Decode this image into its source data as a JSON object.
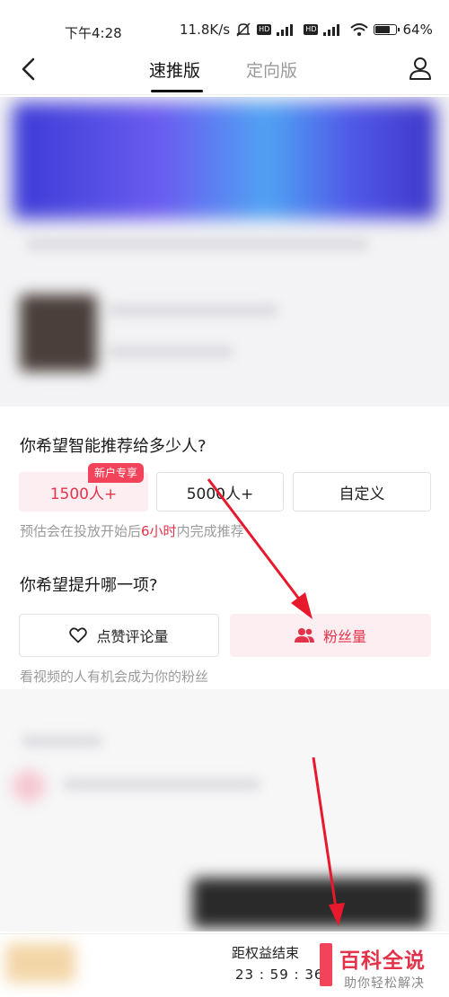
{
  "status_bar": {
    "time": "下午4:28",
    "net_speed": "11.8K/s",
    "hd1": "HD",
    "hd2": "HD",
    "battery": "64%",
    "battery_level": 0.64
  },
  "nav": {
    "tabs": [
      "速推版",
      "定向版"
    ],
    "active_tab": 0
  },
  "audience": {
    "title": "你希望智能推荐给多少人?",
    "options": [
      "1500人+",
      "5000人+",
      "自定义"
    ],
    "selected": 0,
    "new_badge": "新户专享",
    "hint_prefix": "预估会在投放开始后",
    "hint_highlight": "6小时",
    "hint_suffix": "内完成推荐"
  },
  "boost": {
    "title": "你希望提升哪一项?",
    "options": [
      {
        "label": "点赞评论量",
        "icon": "heart-icon"
      },
      {
        "label": "粉丝量",
        "icon": "users-icon"
      }
    ],
    "selected": 1,
    "hint": "看视频的人有机会成为你的粉丝"
  },
  "bottom": {
    "countdown_label": "距权益结束",
    "countdown_time": "23 : 59 : 36"
  },
  "watermark": {
    "title": "百科全说",
    "subtitle": "助你轻松解决"
  },
  "colors": {
    "accent": "#e3334a",
    "selected_bg": "#fdeef1",
    "arrow": "#e8192c"
  }
}
